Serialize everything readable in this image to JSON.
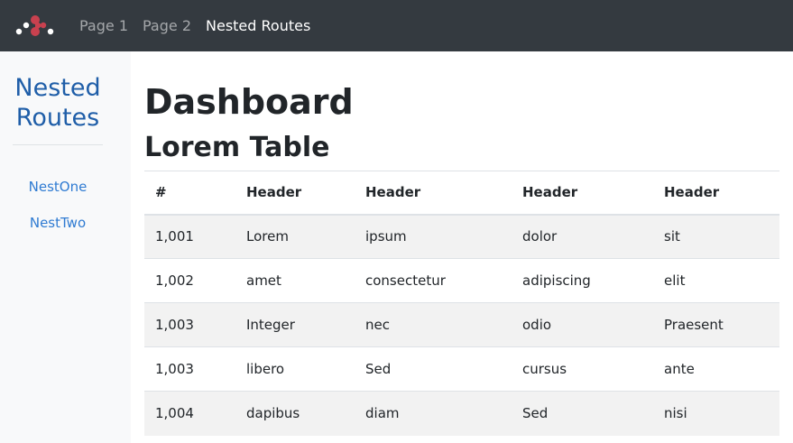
{
  "navbar": {
    "brand_icon": "app-logo-icon",
    "brand_colors": [
      "#ffffff",
      "#c8414f"
    ],
    "links": [
      {
        "label": "Page 1",
        "active": false
      },
      {
        "label": "Page 2",
        "active": false
      },
      {
        "label": "Nested Routes",
        "active": true
      }
    ]
  },
  "sidebar": {
    "title": "Nested Routes",
    "items": [
      {
        "label": "NestOne"
      },
      {
        "label": "NestTwo"
      }
    ]
  },
  "main": {
    "title": "Dashboard",
    "section_title": "Lorem Table",
    "table": {
      "headers": [
        "#",
        "Header",
        "Header",
        "Header",
        "Header"
      ],
      "rows": [
        [
          "1,001",
          "Lorem",
          "ipsum",
          "dolor",
          "sit"
        ],
        [
          "1,002",
          "amet",
          "consectetur",
          "adipiscing",
          "elit"
        ],
        [
          "1,003",
          "Integer",
          "nec",
          "odio",
          "Praesent"
        ],
        [
          "1,003",
          "libero",
          "Sed",
          "cursus",
          "ante"
        ],
        [
          "1,004",
          "dapibus",
          "diam",
          "Sed",
          "nisi"
        ]
      ]
    }
  },
  "colors": {
    "navbar_bg": "#343a40",
    "sidebar_bg": "#f8f9fa",
    "sidebar_title": "#1f5ea8",
    "sidebar_link": "#2f7bd2",
    "stripe": "#f2f2f2"
  }
}
